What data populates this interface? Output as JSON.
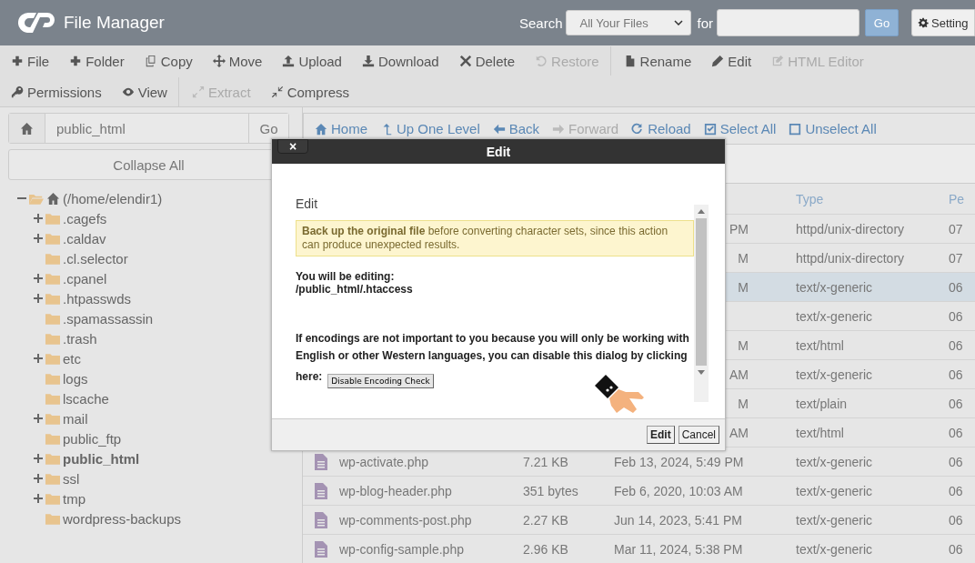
{
  "header": {
    "title": "File Manager",
    "search_label": "Search",
    "scope": "All Your Files",
    "for_label": "for",
    "go": "Go",
    "settings": "Setting"
  },
  "toolbar": [
    [
      [
        {
          "label": "File",
          "kind": "plus",
          "disabled": false
        },
        {
          "label": "Folder",
          "kind": "plus",
          "disabled": false
        },
        {
          "label": "Copy",
          "kind": "copy",
          "disabled": false
        },
        {
          "label": "Move",
          "kind": "move",
          "disabled": false
        },
        {
          "label": "Upload",
          "kind": "upload",
          "disabled": false
        },
        {
          "label": "Download",
          "kind": "download",
          "disabled": false
        },
        {
          "label": "Delete",
          "kind": "delete",
          "disabled": false
        },
        {
          "label": "Restore",
          "kind": "restore",
          "disabled": true
        }
      ],
      [
        {
          "label": "Rename",
          "kind": "file",
          "disabled": false
        },
        {
          "label": "Edit",
          "kind": "pencil",
          "disabled": false
        },
        {
          "label": "HTML Editor",
          "kind": "pencil-square",
          "disabled": true
        }
      ]
    ],
    [
      [
        {
          "label": "Permissions",
          "kind": "key",
          "disabled": false
        },
        {
          "label": "View",
          "kind": "eye",
          "disabled": false
        }
      ],
      [
        {
          "label": "Extract",
          "kind": "expand",
          "disabled": true
        },
        {
          "label": "Compress",
          "kind": "compress",
          "disabled": false
        }
      ]
    ]
  ],
  "sidebar": {
    "path": "public_html",
    "go": "Go",
    "collapse": "Collapse All",
    "tree": [
      {
        "label": "(/home/elendir1)",
        "expanded": true,
        "selected": false,
        "children": [
          {
            "label": ".cagefs",
            "expanded": false,
            "selected": false
          },
          {
            "label": ".caldav",
            "expanded": false,
            "selected": false
          },
          {
            "label": ".cl.selector",
            "selected": false
          },
          {
            "label": ".cpanel",
            "expanded": false,
            "selected": false
          },
          {
            "label": ".htpasswds",
            "expanded": false,
            "selected": false
          },
          {
            "label": ".spamassassin",
            "selected": false
          },
          {
            "label": ".trash",
            "selected": false
          },
          {
            "label": "etc",
            "expanded": false,
            "selected": false
          },
          {
            "label": "logs",
            "selected": false
          },
          {
            "label": "lscache",
            "selected": false
          },
          {
            "label": "mail",
            "expanded": false,
            "selected": false
          },
          {
            "label": "public_ftp",
            "selected": false
          },
          {
            "label": "public_html",
            "expanded": false,
            "selected": true
          },
          {
            "label": "ssl",
            "expanded": false,
            "selected": false
          },
          {
            "label": "tmp",
            "expanded": false,
            "selected": false
          },
          {
            "label": "wordpress-backups",
            "selected": false
          }
        ]
      }
    ]
  },
  "nav": [
    {
      "label": "Home",
      "kind": "home",
      "disabled": false
    },
    {
      "label": "Up One Level",
      "kind": "up",
      "disabled": false
    },
    {
      "label": "Back",
      "kind": "back",
      "disabled": false
    },
    {
      "label": "Forward",
      "kind": "forward",
      "disabled": true
    },
    {
      "label": "Reload",
      "kind": "reload",
      "disabled": false
    },
    {
      "label": "Select All",
      "kind": "check",
      "disabled": false
    },
    {
      "label": "Unselect All",
      "kind": "square",
      "disabled": false
    }
  ],
  "table": {
    "columns": [
      "Type",
      "Pe"
    ],
    "rows": [
      {
        "date": "PM",
        "type": "httpd/unix-directory",
        "perms": "07",
        "selected": false
      },
      {
        "date": "M",
        "type": "httpd/unix-directory",
        "perms": "07",
        "selected": false
      },
      {
        "date": "M",
        "type": "text/x-generic",
        "perms": "06",
        "selected": true
      },
      {
        "type": "text/x-generic",
        "perms": "06",
        "selected": false
      },
      {
        "date": "M",
        "type": "text/html",
        "perms": "06",
        "selected": false
      },
      {
        "date": "AM",
        "type": "text/x-generic",
        "perms": "06",
        "selected": false
      },
      {
        "date": "M",
        "type": "text/plain",
        "perms": "06",
        "selected": false
      },
      {
        "date": "AM",
        "type": "text/html",
        "perms": "06",
        "selected": false
      },
      {
        "name": "wp-activate.php",
        "size": "7.21 KB",
        "date": "Feb 13, 2024, 5:49 PM",
        "type": "text/x-generic",
        "perms": "06",
        "selected": false
      },
      {
        "name": "wp-blog-header.php",
        "size": "351 bytes",
        "date": "Feb 6, 2020, 10:03 AM",
        "type": "text/x-generic",
        "perms": "06",
        "selected": false
      },
      {
        "name": "wp-comments-post.php",
        "size": "2.27 KB",
        "date": "Jun 14, 2023, 5:41 PM",
        "type": "text/x-generic",
        "perms": "06",
        "selected": false
      },
      {
        "name": "wp-config-sample.php",
        "size": "2.96 KB",
        "date": "Mar 11, 2024, 5:38 PM",
        "type": "text/x-generic",
        "perms": "06",
        "selected": false
      }
    ]
  },
  "dialog": {
    "title": "Edit",
    "close": "×",
    "heading": "Edit",
    "warning": "**Back up the original file** before converting character sets, since this action can produce unexpected results.",
    "editing_label": "You will be editing:",
    "editing_path": "/public_html/.htaccess",
    "info": "If encodings are not important to you because you will only be working with English or other Western languages, you can disable this dialog by clicking",
    "here": "here:",
    "disable_button": "Disable Encoding Check",
    "buttons": [
      "Edit",
      "Cancel"
    ]
  }
}
